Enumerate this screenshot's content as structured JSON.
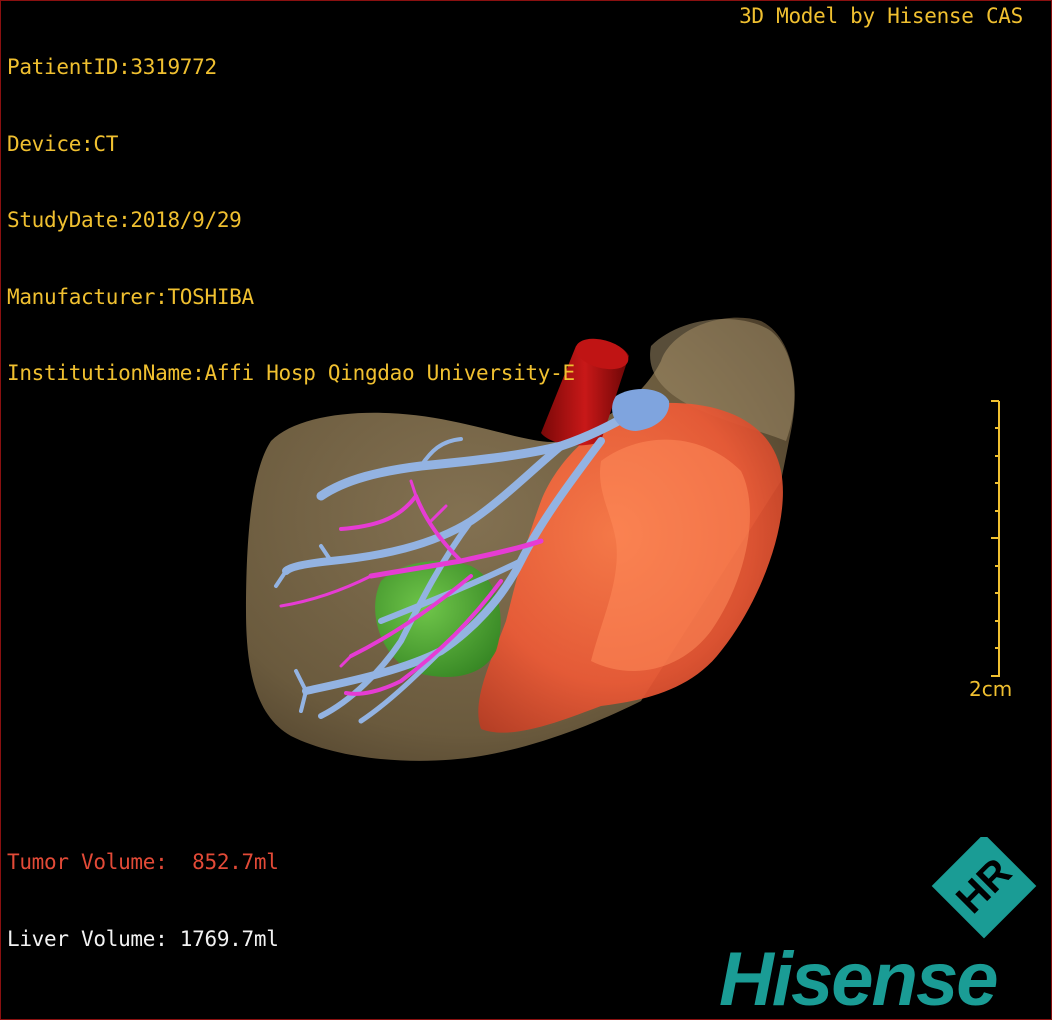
{
  "patient_info": {
    "patient_id": "PatientID:3319772",
    "device": "Device:CT",
    "study_date": "StudyDate:2018/9/29",
    "manufacturer": "Manufacturer:TOSHIBA",
    "institution": "InstitutionName:Affi Hosp Qingdao University-E"
  },
  "credit": "3D Model by Hisense CAS",
  "scale_bar": {
    "label": "2cm"
  },
  "volumes": {
    "tumor": "Tumor Volume:  852.7ml",
    "liver": "Liver Volume: 1769.7ml"
  },
  "brand": {
    "logo_text": "Hisense",
    "emblem_letters": "HR",
    "color": "#1a9c95"
  },
  "colors": {
    "hud_text": "#f0c030",
    "tumor_text": "#e24a37",
    "liver_text": "#f2f2f2",
    "liver": "#8a7552",
    "tumor": "#ee5a36",
    "ivc": "#b01010",
    "portal_vein": "#90b0e0",
    "hepatic_artery": "#e040d0",
    "lesion": "#44b030"
  }
}
